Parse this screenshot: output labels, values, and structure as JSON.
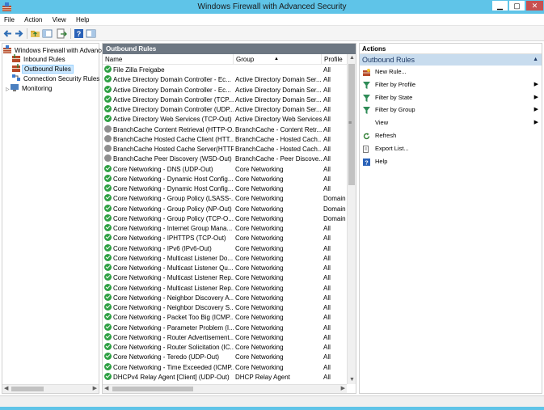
{
  "window": {
    "title": "Windows Firewall with Advanced Security",
    "minimize": "▁",
    "maximize": "▢",
    "close": "✕"
  },
  "menu": [
    "File",
    "Action",
    "View",
    "Help"
  ],
  "tree": {
    "root": "Windows Firewall with Advance",
    "items": [
      {
        "label": "Inbound Rules",
        "icon": "inbound-rules-icon",
        "selected": false
      },
      {
        "label": "Outbound Rules",
        "icon": "outbound-rules-icon",
        "selected": true
      },
      {
        "label": "Connection Security Rules",
        "icon": "connection-security-icon",
        "selected": false
      },
      {
        "label": "Monitoring",
        "icon": "monitoring-icon",
        "selected": false
      }
    ]
  },
  "center": {
    "header": "Outbound Rules",
    "columns": [
      "Name",
      "Group",
      "Profile"
    ],
    "rows": [
      {
        "name": "File Zilla Freigabe",
        "group": "",
        "profile": "All",
        "enabled": true
      },
      {
        "name": "Active Directory Domain Controller - Ec...",
        "group": "Active Directory Domain Ser...",
        "profile": "All",
        "enabled": true
      },
      {
        "name": "Active Directory Domain Controller - Ec...",
        "group": "Active Directory Domain Ser...",
        "profile": "All",
        "enabled": true
      },
      {
        "name": "Active Directory Domain Controller (TCP...",
        "group": "Active Directory Domain Ser...",
        "profile": "All",
        "enabled": true
      },
      {
        "name": "Active Directory Domain Controller (UDP...",
        "group": "Active Directory Domain Ser...",
        "profile": "All",
        "enabled": true
      },
      {
        "name": "Active Directory Web Services (TCP-Out)",
        "group": "Active Directory Web Services",
        "profile": "All",
        "enabled": true
      },
      {
        "name": "BranchCache Content Retrieval (HTTP-O...",
        "group": "BranchCache - Content Retr...",
        "profile": "All",
        "enabled": false
      },
      {
        "name": "BranchCache Hosted Cache Client (HTT...",
        "group": "BranchCache - Hosted Cach...",
        "profile": "All",
        "enabled": false
      },
      {
        "name": "BranchCache Hosted Cache Server(HTTP...",
        "group": "BranchCache - Hosted Cach...",
        "profile": "All",
        "enabled": false
      },
      {
        "name": "BranchCache Peer Discovery (WSD-Out)",
        "group": "BranchCache - Peer Discove...",
        "profile": "All",
        "enabled": false
      },
      {
        "name": "Core Networking - DNS (UDP-Out)",
        "group": "Core Networking",
        "profile": "All",
        "enabled": true
      },
      {
        "name": "Core Networking - Dynamic Host Config...",
        "group": "Core Networking",
        "profile": "All",
        "enabled": true
      },
      {
        "name": "Core Networking - Dynamic Host Config...",
        "group": "Core Networking",
        "profile": "All",
        "enabled": true
      },
      {
        "name": "Core Networking - Group Policy (LSASS-...",
        "group": "Core Networking",
        "profile": "Domain",
        "enabled": true
      },
      {
        "name": "Core Networking - Group Policy (NP-Out)",
        "group": "Core Networking",
        "profile": "Domain",
        "enabled": true
      },
      {
        "name": "Core Networking - Group Policy (TCP-O...",
        "group": "Core Networking",
        "profile": "Domain",
        "enabled": true
      },
      {
        "name": "Core Networking - Internet Group Mana...",
        "group": "Core Networking",
        "profile": "All",
        "enabled": true
      },
      {
        "name": "Core Networking - IPHTTPS (TCP-Out)",
        "group": "Core Networking",
        "profile": "All",
        "enabled": true
      },
      {
        "name": "Core Networking - IPv6 (IPv6-Out)",
        "group": "Core Networking",
        "profile": "All",
        "enabled": true
      },
      {
        "name": "Core Networking - Multicast Listener Do...",
        "group": "Core Networking",
        "profile": "All",
        "enabled": true
      },
      {
        "name": "Core Networking - Multicast Listener Qu...",
        "group": "Core Networking",
        "profile": "All",
        "enabled": true
      },
      {
        "name": "Core Networking - Multicast Listener Rep...",
        "group": "Core Networking",
        "profile": "All",
        "enabled": true
      },
      {
        "name": "Core Networking - Multicast Listener Rep...",
        "group": "Core Networking",
        "profile": "All",
        "enabled": true
      },
      {
        "name": "Core Networking - Neighbor Discovery A...",
        "group": "Core Networking",
        "profile": "All",
        "enabled": true
      },
      {
        "name": "Core Networking - Neighbor Discovery S...",
        "group": "Core Networking",
        "profile": "All",
        "enabled": true
      },
      {
        "name": "Core Networking - Packet Too Big (ICMP...",
        "group": "Core Networking",
        "profile": "All",
        "enabled": true
      },
      {
        "name": "Core Networking - Parameter Problem (I...",
        "group": "Core Networking",
        "profile": "All",
        "enabled": true
      },
      {
        "name": "Core Networking - Router Advertisement...",
        "group": "Core Networking",
        "profile": "All",
        "enabled": true
      },
      {
        "name": "Core Networking - Router Solicitation (IC...",
        "group": "Core Networking",
        "profile": "All",
        "enabled": true
      },
      {
        "name": "Core Networking - Teredo (UDP-Out)",
        "group": "Core Networking",
        "profile": "All",
        "enabled": true
      },
      {
        "name": "Core Networking - Time Exceeded (ICMP...",
        "group": "Core Networking",
        "profile": "All",
        "enabled": true
      },
      {
        "name": "DHCPv4 Relay Agent [Client] (UDP-Out)",
        "group": "DHCP Relay Agent",
        "profile": "All",
        "enabled": true
      }
    ]
  },
  "actions": {
    "title": "Actions",
    "section": "Outbound Rules",
    "items": [
      {
        "label": "New Rule...",
        "icon": "new-rule-icon",
        "submenu": false
      },
      {
        "label": "Filter by Profile",
        "icon": "filter-icon",
        "submenu": true
      },
      {
        "label": "Filter by State",
        "icon": "filter-icon",
        "submenu": true
      },
      {
        "label": "Filter by Group",
        "icon": "filter-icon",
        "submenu": true
      },
      {
        "label": "View",
        "icon": "",
        "submenu": true
      },
      {
        "label": "Refresh",
        "icon": "refresh-icon",
        "submenu": false
      },
      {
        "label": "Export List...",
        "icon": "export-list-icon",
        "submenu": false
      },
      {
        "label": "Help",
        "icon": "help-icon",
        "submenu": false
      }
    ]
  },
  "colors": {
    "titlebar": "#5fc4e8",
    "pane_header": "#6d7782",
    "actions_section": "#c8dcee",
    "enabled": "#2ea043",
    "disabled": "#8e8e8e",
    "selection": "#cce8ff"
  }
}
